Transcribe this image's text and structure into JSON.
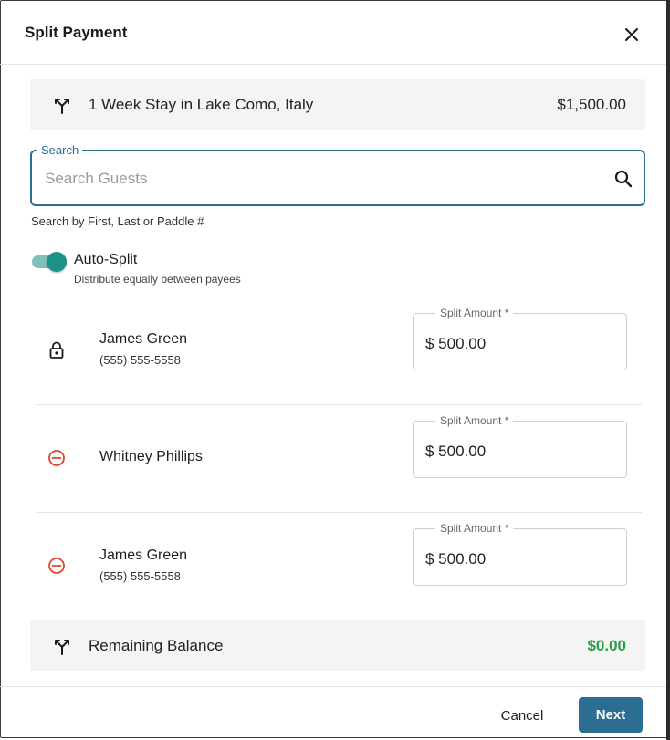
{
  "dialog": {
    "title": "Split Payment",
    "close_icon": "close-icon"
  },
  "item": {
    "icon": "split-arrows-icon",
    "name": "1 Week Stay in Lake Como, Italy",
    "price": "$1,500.00"
  },
  "search": {
    "legend": "Search",
    "placeholder": "Search Guests",
    "value": "",
    "icon": "search-icon",
    "helper": "Search by First, Last or Paddle #"
  },
  "auto_split": {
    "on": true,
    "label": "Auto-Split",
    "description": "Distribute equally between payees",
    "color": "#1d9186"
  },
  "payees": [
    {
      "icon": "lock-icon",
      "name": "James Green",
      "phone": "(555) 555-5558",
      "amount_label": "Split Amount *",
      "amount": "$ 500.00"
    },
    {
      "icon": "remove-circle-icon",
      "name": "Whitney Phillips",
      "phone": "",
      "amount_label": "Split Amount *",
      "amount": "$ 500.00"
    },
    {
      "icon": "remove-circle-icon",
      "name": "James Green",
      "phone": "(555) 555-5558",
      "amount_label": "Split Amount *",
      "amount": "$ 500.00"
    }
  ],
  "remaining": {
    "icon": "split-arrows-icon",
    "label": "Remaining Balance",
    "amount": "$0.00",
    "color": "#27a047"
  },
  "footer": {
    "cancel_label": "Cancel",
    "next_label": "Next"
  },
  "colors": {
    "primary": "#2b6d93",
    "danger": "#d9482b"
  }
}
